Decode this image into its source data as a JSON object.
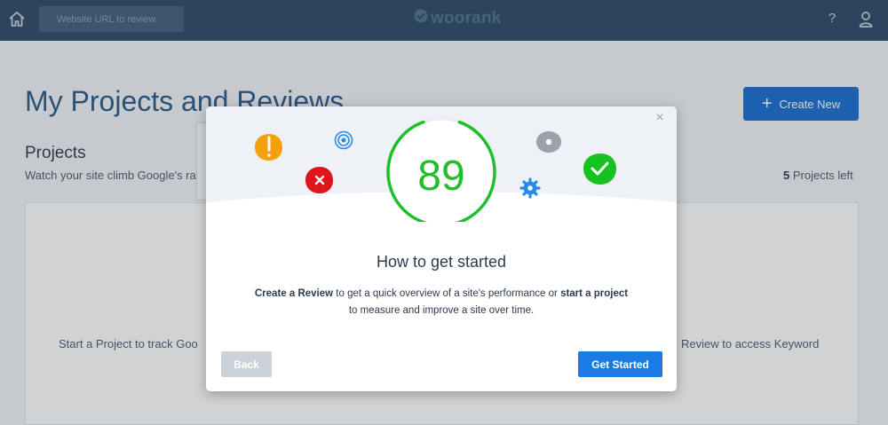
{
  "topbar": {
    "url_placeholder": "Website URL to review",
    "brand": "woorank",
    "help_label": "?"
  },
  "page": {
    "title": "My Projects and Reviews",
    "create_label": "Create New",
    "projects_heading": "Projects",
    "projects_subtitle": "Watch your site climb Google's ra",
    "projects_left_count": "5",
    "projects_left_label": " Projects left",
    "empty_left": "Start a Project to track Goo",
    "empty_right": "Review to access Keyword"
  },
  "modal": {
    "score": "89",
    "score_fraction": 0.89,
    "title": "How to get started",
    "desc_bold_1": "Create a Review",
    "desc_text_1": " to get a quick overview of a site's performance or ",
    "desc_bold_2": "start a project",
    "desc_text_2": "to measure and improve a site over time.",
    "back_label": "Back",
    "start_label": "Get Started",
    "close_label": "×"
  },
  "colors": {
    "topbar": "#2e4a66",
    "accent": "#1c7be0",
    "score_green": "#1fbf2a",
    "warning": "#f5a10d",
    "error": "#e0141c",
    "success": "#16c21f",
    "neutral": "#9aa3ad"
  },
  "icons": [
    "home-icon",
    "woorank-check-icon",
    "help-icon",
    "user-icon",
    "plus-icon",
    "close-icon",
    "warning-icon",
    "error-icon",
    "target-icon",
    "eye-icon",
    "gear-icon",
    "check-icon"
  ]
}
